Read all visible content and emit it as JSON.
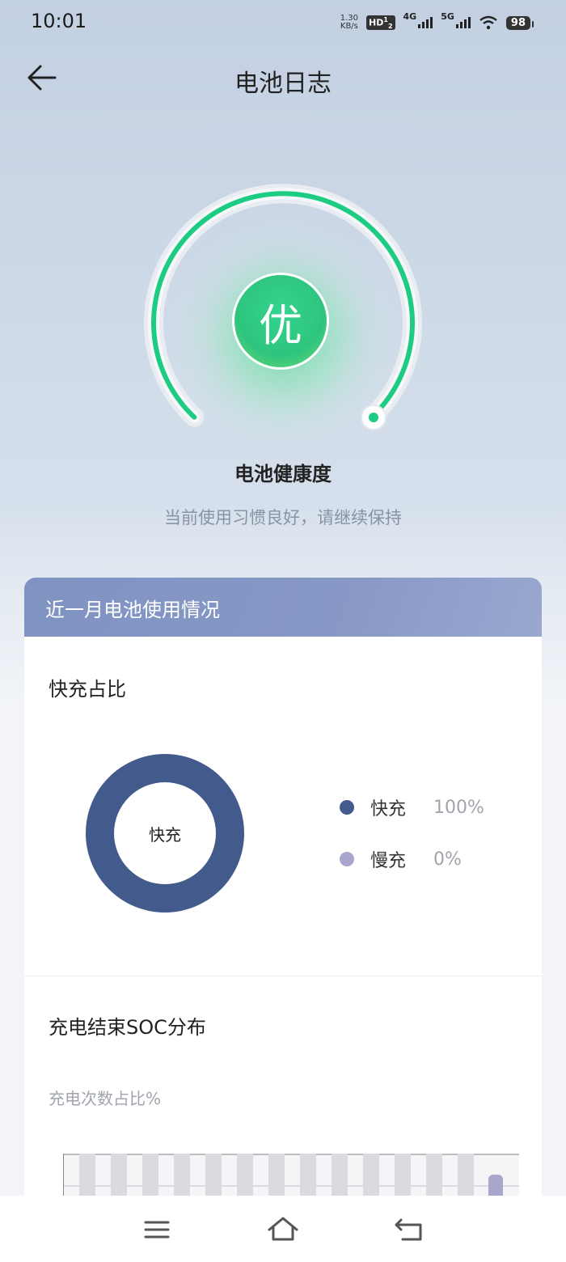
{
  "status_bar": {
    "time": "10:01",
    "speed_value": "1.30",
    "speed_unit": "KB/s",
    "hd": "HD",
    "hd_sup": "1",
    "hd_sub": "2",
    "net1": "4G",
    "net2": "5G",
    "battery": "98"
  },
  "header": {
    "title": "电池日志",
    "back_icon": "arrow-left-icon"
  },
  "health": {
    "grade": "优",
    "title": "电池健康度",
    "subtitle": "当前使用习惯良好，请继续保持",
    "arc_color": "#1ccc82"
  },
  "card": {
    "title": "近一月电池使用情况",
    "header_color": "#8396c4",
    "fast_charge_section": {
      "title": "快充占比",
      "donut_center": "快充",
      "legend": [
        {
          "label": "快充",
          "value": "100%",
          "color": "#435a8c"
        },
        {
          "label": "慢充",
          "value": "0%",
          "color": "#a8a6cc"
        }
      ]
    },
    "soc_section": {
      "title": "充电结束SOC分布",
      "y_label": "充电次数占比%"
    }
  },
  "nav_bar": {
    "items": [
      "menu-icon",
      "home-icon",
      "back-icon"
    ]
  }
}
